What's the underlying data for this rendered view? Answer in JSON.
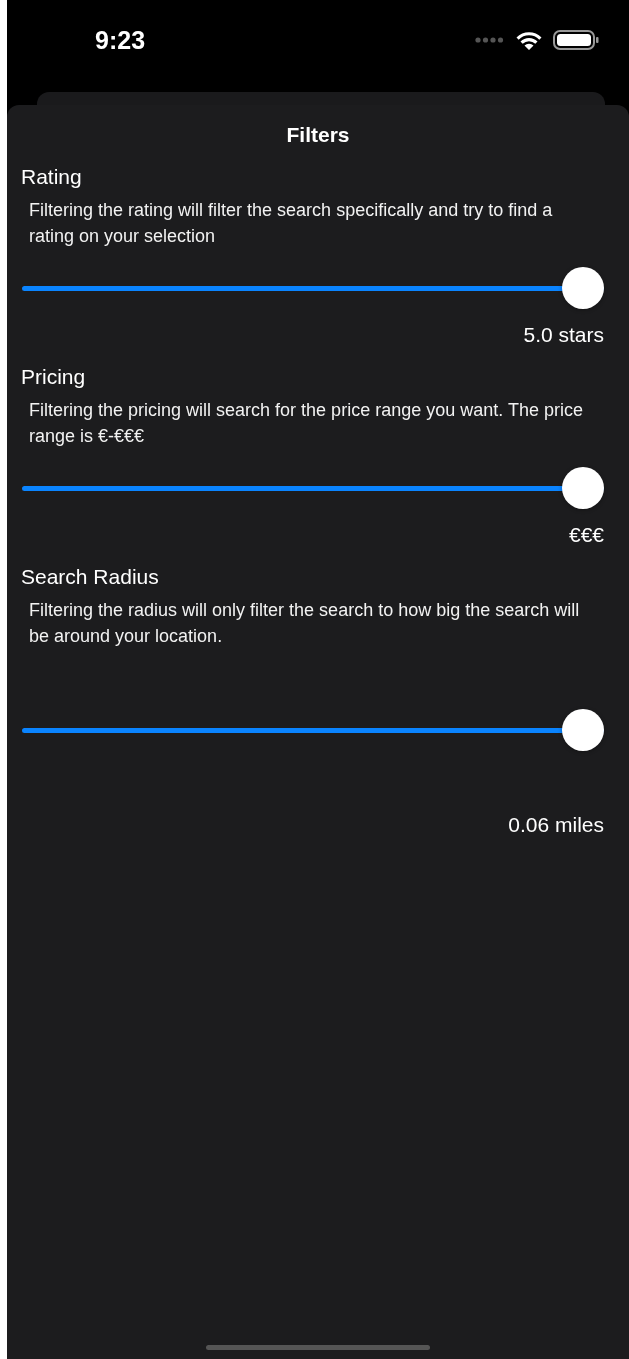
{
  "status_bar": {
    "time": "9:23"
  },
  "sheet": {
    "title": "Filters"
  },
  "filters": [
    {
      "label": "Rating",
      "description": "Filtering the rating will filter the search specifically and try to find a rating on your selection",
      "level": 1.0,
      "reading": "5.0 stars"
    },
    {
      "label": "Pricing",
      "description": "Filtering the pricing will search for the price range you want. The price range is €-€€€",
      "level": 1.0,
      "reading": "€€€"
    },
    {
      "label": "Search Radius",
      "description": "Filtering the radius will only filter the search to how big the search will be around your location.",
      "level": 1.0,
      "reading": "0.06 miles"
    }
  ]
}
